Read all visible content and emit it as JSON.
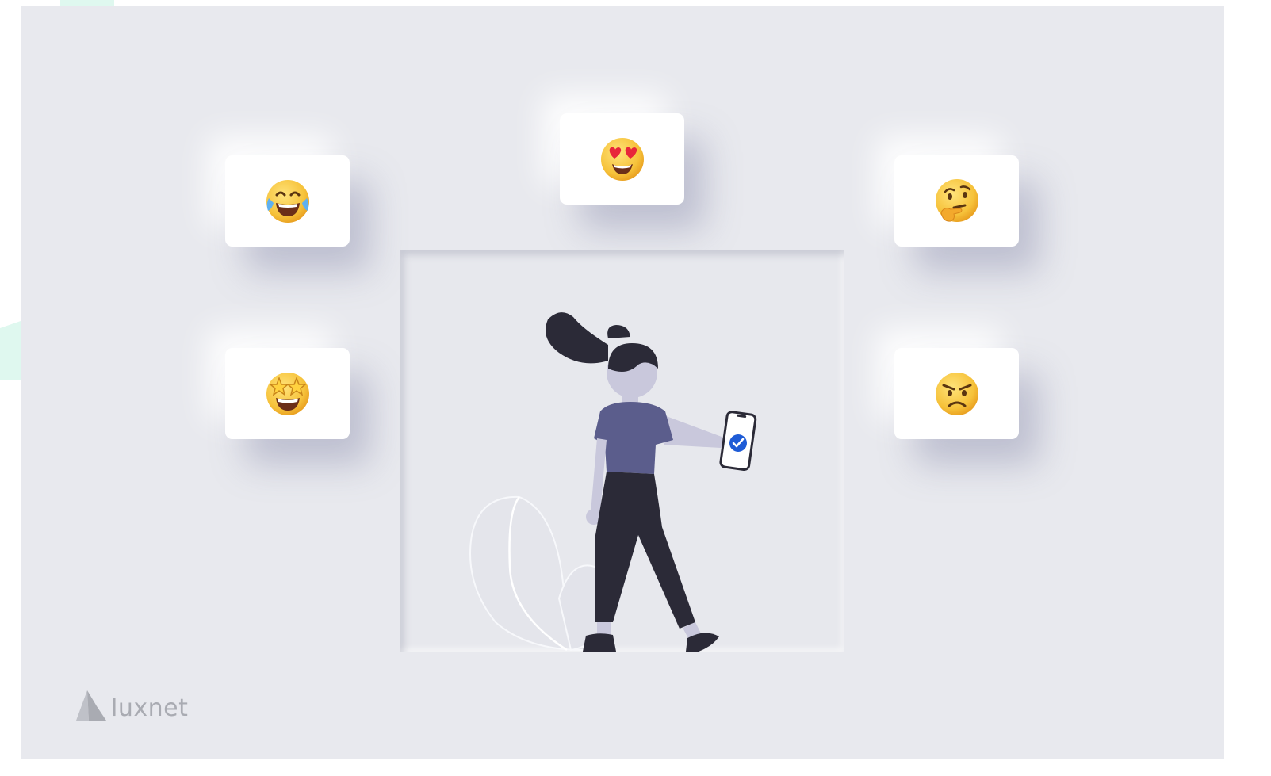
{
  "brand": {
    "name": "luxnet",
    "text_color": "#a9abb2"
  },
  "colors": {
    "background": "#e8e9ee",
    "card": "#ffffff",
    "accent": "#dff8ef",
    "shirt": "#5b5d8c",
    "pants": "#2b2a37",
    "check": "#1e5bd6"
  },
  "emoji_cards": [
    {
      "name": "face-with-tears-of-joy",
      "emoji": "😂"
    },
    {
      "name": "smiling-face-with-heart-eyes",
      "emoji": "😍"
    },
    {
      "name": "thinking-face",
      "emoji": "🤔"
    },
    {
      "name": "star-struck",
      "emoji": "🤩"
    },
    {
      "name": "angry-face",
      "emoji": "😠"
    }
  ],
  "illustration": {
    "subject": "woman-holding-phone-with-checkmark",
    "icons": [
      "check-icon",
      "phone-icon"
    ]
  }
}
